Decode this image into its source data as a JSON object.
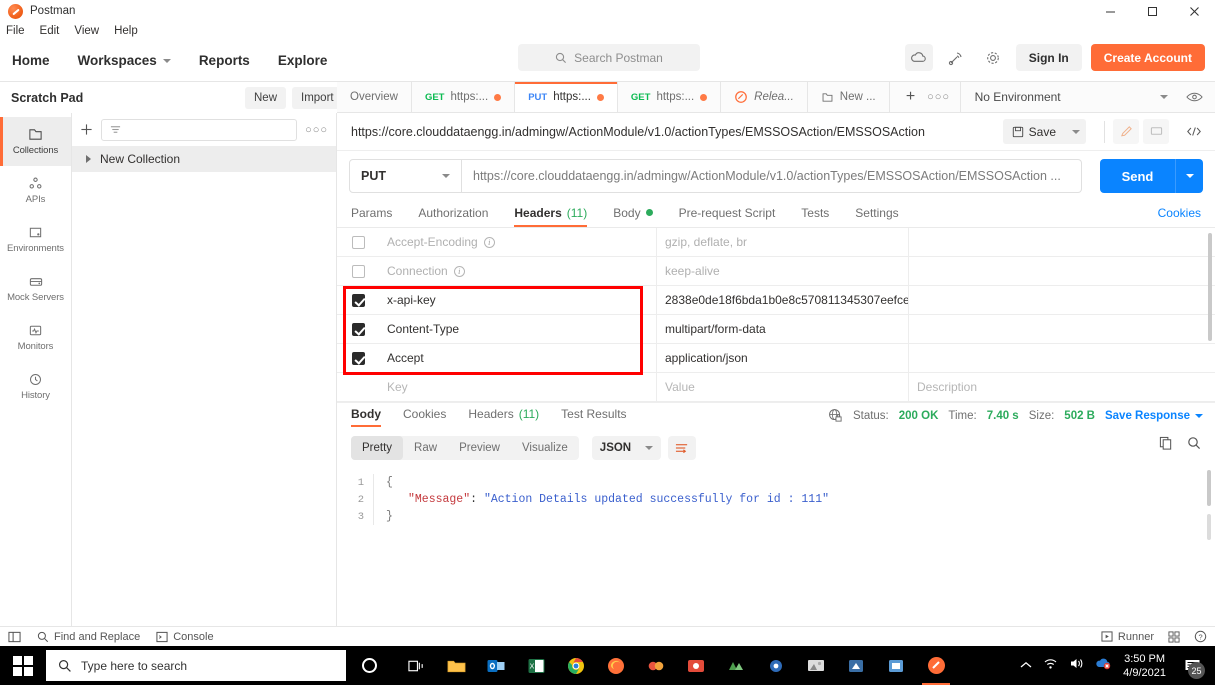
{
  "window": {
    "app_title": "Postman",
    "minimize": "─",
    "maximize": "❐",
    "close": "✕"
  },
  "menubar": {
    "items": [
      "File",
      "Edit",
      "View",
      "Help"
    ]
  },
  "topnav": {
    "items": [
      "Home",
      "Workspaces",
      "Reports",
      "Explore"
    ],
    "search_placeholder": "Search Postman",
    "sign_in": "Sign In",
    "create_account": "Create Account",
    "icons": [
      "cloud-sync-icon",
      "satellite-icon",
      "gear-icon"
    ]
  },
  "scratchbar": {
    "label": "Scratch Pad",
    "new_button": "New",
    "import_button": "Import"
  },
  "rail": {
    "items": [
      {
        "label": "Collections",
        "icon": "collections-icon",
        "active": true
      },
      {
        "label": "APIs",
        "icon": "apis-icon",
        "active": false
      },
      {
        "label": "Environments",
        "icon": "environments-icon",
        "active": false
      },
      {
        "label": "Mock Servers",
        "icon": "mock-servers-icon",
        "active": false
      },
      {
        "label": "Monitors",
        "icon": "monitors-icon",
        "active": false
      },
      {
        "label": "History",
        "icon": "history-icon",
        "active": false
      }
    ]
  },
  "collections_pane": {
    "filter_placeholder": "",
    "collection_name": "New Collection"
  },
  "tabs": [
    {
      "label": "Overview",
      "method": "",
      "active": false,
      "unsaved": false
    },
    {
      "label": "https:...",
      "method": "GET",
      "active": false,
      "unsaved": true
    },
    {
      "label": "https:...",
      "method": "PUT",
      "active": true,
      "unsaved": true
    },
    {
      "label": "https:...",
      "method": "GET",
      "active": false,
      "unsaved": true
    },
    {
      "label": "Relea...",
      "method": "",
      "active": false,
      "unsaved": false
    },
    {
      "label": "New ...",
      "method": "",
      "active": false,
      "unsaved": false
    }
  ],
  "tabbar": {
    "plus": "+",
    "more": "○○○"
  },
  "environment": {
    "selected": "No Environment"
  },
  "request": {
    "title_url": "https://core.clouddataengg.in/admingw/ActionModule/v1.0/actionTypes/EMSSOSAction/EMSSOSAction",
    "save_label": "Save",
    "method": "PUT",
    "url_value": "https://core.clouddataengg.in/admingw/ActionModule/v1.0/actionTypes/EMSSOSAction/EMSSOSAction ...",
    "send_label": "Send",
    "tabs": [
      {
        "label": "Params",
        "active": false
      },
      {
        "label": "Authorization",
        "active": false
      },
      {
        "label": "Headers",
        "count": "(11)",
        "active": true
      },
      {
        "label": "Body",
        "dot": true,
        "active": false
      },
      {
        "label": "Pre-request Script",
        "active": false
      },
      {
        "label": "Tests",
        "active": false
      },
      {
        "label": "Settings",
        "active": false
      }
    ],
    "cookies_link": "Cookies"
  },
  "headers_table": {
    "placeholder_key": "Key",
    "placeholder_value": "Value",
    "placeholder_description": "Description",
    "rows": [
      {
        "checked": false,
        "muted": true,
        "key": "Accept-Encoding",
        "info": true,
        "value": "gzip, deflate, br",
        "description": ""
      },
      {
        "checked": false,
        "muted": true,
        "key": "Connection",
        "info": true,
        "value": "keep-alive",
        "description": ""
      },
      {
        "checked": true,
        "muted": false,
        "key": "x-api-key",
        "info": false,
        "value": "2838e0de18f6bda1b0e8c570811345307eefce...",
        "description": ""
      },
      {
        "checked": true,
        "muted": false,
        "key": "Content-Type",
        "info": false,
        "value": "multipart/form-data",
        "description": ""
      },
      {
        "checked": true,
        "muted": false,
        "key": "Accept",
        "info": false,
        "value": "application/json",
        "description": ""
      }
    ],
    "highlight_color": "#ff0000"
  },
  "response": {
    "tabs": [
      {
        "label": "Body",
        "active": true
      },
      {
        "label": "Cookies",
        "active": false
      },
      {
        "label": "Headers",
        "count": "(11)",
        "active": false
      },
      {
        "label": "Test Results",
        "active": false
      }
    ],
    "status_label": "Status:",
    "status_value": "200 OK",
    "time_label": "Time:",
    "time_value": "7.40 s",
    "size_label": "Size:",
    "size_value": "502 B",
    "save_response": "Save Response",
    "view_modes": [
      "Pretty",
      "Raw",
      "Preview",
      "Visualize"
    ],
    "active_view": "Pretty",
    "format": "JSON",
    "body_lines": [
      {
        "num": "1",
        "brace": "{",
        "key": "",
        "value": ""
      },
      {
        "num": "2",
        "brace": "",
        "key": "\"Message\"",
        "value": "\"Action Details updated successfully for id : 111\""
      },
      {
        "num": "3",
        "brace": "}",
        "key": "",
        "value": ""
      }
    ]
  },
  "statusbar": {
    "find_replace": "Find and Replace",
    "console": "Console",
    "runner": "Runner"
  },
  "taskbar": {
    "search_placeholder": "Type here to search",
    "time": "3:50 PM",
    "date": "4/9/2021",
    "notification_count": "25"
  }
}
